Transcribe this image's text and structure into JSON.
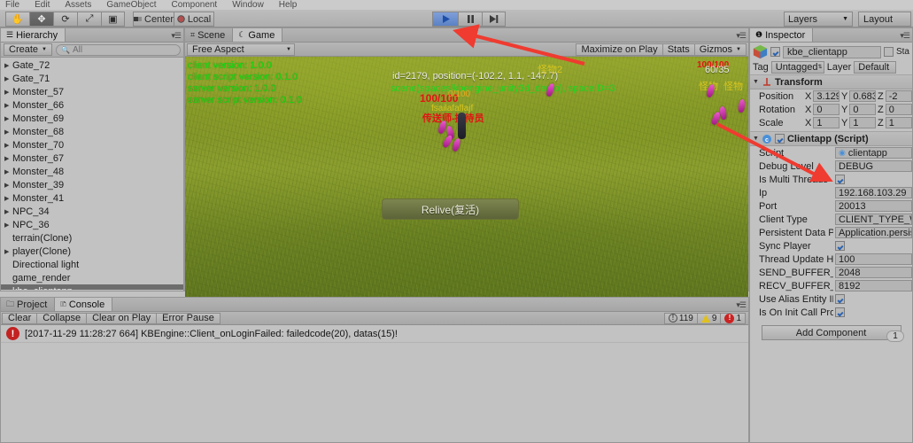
{
  "menubar": {
    "items": [
      "File",
      "Edit",
      "Assets",
      "GameObject",
      "Component",
      "Window",
      "Help"
    ]
  },
  "toolbar": {
    "transform_tools": [
      {
        "name": "hand-tool",
        "glyph": "✋",
        "active": false
      },
      {
        "name": "move-tool",
        "glyph": "✥",
        "active": true
      },
      {
        "name": "rotate-tool",
        "glyph": "⟳",
        "active": false
      },
      {
        "name": "scale-tool",
        "glyph": "⤢",
        "active": false
      },
      {
        "name": "rect-tool",
        "glyph": "▣",
        "active": false
      }
    ],
    "pivot_label": "Center",
    "space_label": "Local",
    "play_label": "▶",
    "pause_label": "❚❚",
    "step_label": "▶❙",
    "layers_label": "Layers",
    "layout_label": "Layout"
  },
  "hierarchy": {
    "tab_label": "Hierarchy",
    "create_label": "Create",
    "search_placeholder": "All",
    "items": [
      {
        "label": "Gate_72",
        "expandable": true,
        "selected": false
      },
      {
        "label": "Gate_71",
        "expandable": true,
        "selected": false
      },
      {
        "label": "Monster_57",
        "expandable": true,
        "selected": false
      },
      {
        "label": "Monster_66",
        "expandable": true,
        "selected": false
      },
      {
        "label": "Monster_69",
        "expandable": true,
        "selected": false
      },
      {
        "label": "Monster_68",
        "expandable": true,
        "selected": false
      },
      {
        "label": "Monster_70",
        "expandable": true,
        "selected": false
      },
      {
        "label": "Monster_67",
        "expandable": true,
        "selected": false
      },
      {
        "label": "Monster_48",
        "expandable": true,
        "selected": false
      },
      {
        "label": "Monster_39",
        "expandable": true,
        "selected": false
      },
      {
        "label": "Monster_41",
        "expandable": true,
        "selected": false
      },
      {
        "label": "NPC_34",
        "expandable": true,
        "selected": false
      },
      {
        "label": "NPC_36",
        "expandable": true,
        "selected": false
      },
      {
        "label": "terrain(Clone)",
        "expandable": false,
        "selected": false
      },
      {
        "label": "player(Clone)",
        "expandable": true,
        "selected": false
      },
      {
        "label": "Directional light",
        "expandable": false,
        "selected": false
      },
      {
        "label": "game_render",
        "expandable": false,
        "selected": false
      },
      {
        "label": "kbe_clientapp",
        "expandable": false,
        "selected": true
      }
    ]
  },
  "gameview": {
    "scene_tab_label": "Scene",
    "game_tab_label": "Game",
    "aspect_label": "Free Aspect",
    "maximize_label": "Maximize on Play",
    "stats_label": "Stats",
    "gizmos_label": "Gizmos",
    "debug_lines": [
      "client version: 1.0.0",
      "client script version: 0.1.0",
      "server version: 1.0.0",
      "server script version: 0.1.0"
    ],
    "player_info": "id=2179, position=(-102.2, 1.1, -147.7)",
    "scene_info": "scene(spaces/kbengine_unity3d_demo), spaceID=3",
    "hp_text": "100/100",
    "mp_text": "0/100",
    "npc_label_1": "fsailafaflajf",
    "npc_label_2": "传送师-接待员",
    "monster_label": "怪物2",
    "monster_hp_right": "100/100",
    "monster_hp_right2": "60/35",
    "monster_label_right": "怪物",
    "monster_label_right2": "怪物",
    "relive_label": "Relive(复活)"
  },
  "inspector": {
    "tab_label": "Inspector",
    "object_name": "kbe_clientapp",
    "object_enabled": true,
    "static_label": "Sta",
    "tag_label": "Tag",
    "tag_value": "Untagged",
    "layer_label": "Layer",
    "layer_value": "Default",
    "transform": {
      "title": "Transform",
      "rows": [
        {
          "label": "Position",
          "x": "3.12901",
          "y": "0.68378",
          "z": "-2"
        },
        {
          "label": "Rotation",
          "x": "0",
          "y": "0",
          "z": "0"
        },
        {
          "label": "Scale",
          "x": "1",
          "y": "1",
          "z": "1"
        }
      ]
    },
    "clientapp": {
      "title": "Clientapp (Script)",
      "enabled": true,
      "props": [
        {
          "label": "Script",
          "value": "clientapp",
          "type": "object"
        },
        {
          "label": "Debug Level",
          "value": "DEBUG",
          "type": "text"
        },
        {
          "label": "Is Multi Threads",
          "value": true,
          "type": "bool"
        },
        {
          "label": "Ip",
          "value": "192.168.103.29",
          "type": "text"
        },
        {
          "label": "Port",
          "value": "20013",
          "type": "text"
        },
        {
          "label": "Client Type",
          "value": "CLIENT_TYPE_WI",
          "type": "text"
        },
        {
          "label": "Persistent Data Path",
          "value": "Application.persis",
          "type": "text"
        },
        {
          "label": "Sync Player",
          "value": true,
          "type": "bool"
        },
        {
          "label": "Thread Update HZ",
          "value": "100",
          "type": "text"
        },
        {
          "label": "SEND_BUFFER_MAX",
          "value": "2048",
          "type": "text"
        },
        {
          "label": "RECV_BUFFER_MAX",
          "value": "8192",
          "type": "text"
        },
        {
          "label": "Use Alias Entity ID",
          "value": true,
          "type": "bool"
        },
        {
          "label": "Is On Init Call Prope",
          "value": true,
          "type": "bool"
        }
      ]
    },
    "add_component_label": "Add Component"
  },
  "console": {
    "project_tab_label": "Project",
    "console_tab_label": "Console",
    "buttons": [
      "Clear",
      "Collapse",
      "Clear on Play",
      "Error Pause"
    ],
    "info_count": "119",
    "warn_count": "9",
    "error_count": "1",
    "log_message": "[2017-11-29 11:28:27 664] KBEngine::Client_onLoginFailed: failedcode(20), datas(15)!",
    "log_badge": "1"
  },
  "colors": {
    "accent_play": "#5b82c6",
    "error_red": "#cc2222",
    "warn_yellow": "#e0c020",
    "debug_green": "#13e013",
    "arrow_red": "#ef3b30"
  }
}
